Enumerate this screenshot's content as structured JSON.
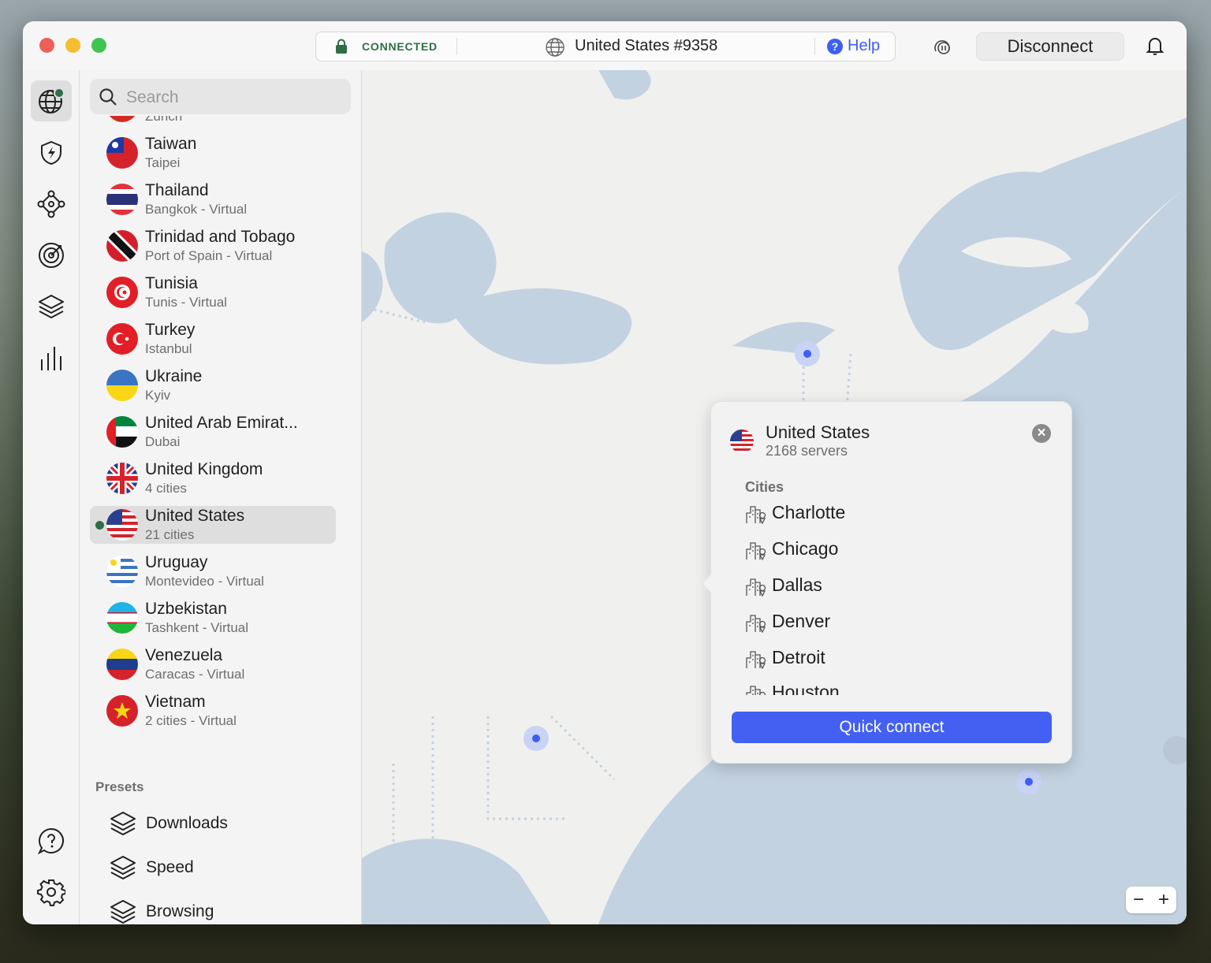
{
  "titlebar": {
    "status": "CONNECTED",
    "server": "United States #9358",
    "help": "Help",
    "disconnect": "Disconnect"
  },
  "search": {
    "placeholder": "Search"
  },
  "countries": [
    {
      "name": "",
      "sub": "Zurich"
    },
    {
      "name": "Taiwan",
      "sub": "Taipei"
    },
    {
      "name": "Thailand",
      "sub": "Bangkok - Virtual"
    },
    {
      "name": "Trinidad and Tobago",
      "sub": "Port of Spain - Virtual"
    },
    {
      "name": "Tunisia",
      "sub": "Tunis - Virtual"
    },
    {
      "name": "Turkey",
      "sub": "Istanbul"
    },
    {
      "name": "Ukraine",
      "sub": "Kyiv"
    },
    {
      "name": "United Arab Emirat...",
      "sub": "Dubai"
    },
    {
      "name": "United Kingdom",
      "sub": "4 cities"
    },
    {
      "name": "United States",
      "sub": "21 cities"
    },
    {
      "name": "Uruguay",
      "sub": "Montevideo - Virtual"
    },
    {
      "name": "Uzbekistan",
      "sub": "Tashkent - Virtual"
    },
    {
      "name": "Venezuela",
      "sub": "Caracas - Virtual"
    },
    {
      "name": "Vietnam",
      "sub": "2 cities - Virtual"
    }
  ],
  "presets": {
    "heading": "Presets",
    "items": [
      "Downloads",
      "Speed",
      "Browsing"
    ]
  },
  "popup": {
    "title": "United States",
    "subtitle": "2168 servers",
    "cities_heading": "Cities",
    "cities": [
      "Charlotte",
      "Chicago",
      "Dallas",
      "Denver",
      "Detroit",
      "Houston"
    ],
    "quick_connect": "Quick connect"
  },
  "zoom": {
    "minus": "−",
    "plus": "+"
  },
  "colors": {
    "accent": "#4360f2",
    "connected": "#2e6d46",
    "water": "#c3d2e1",
    "land": "#f0f0ee"
  }
}
